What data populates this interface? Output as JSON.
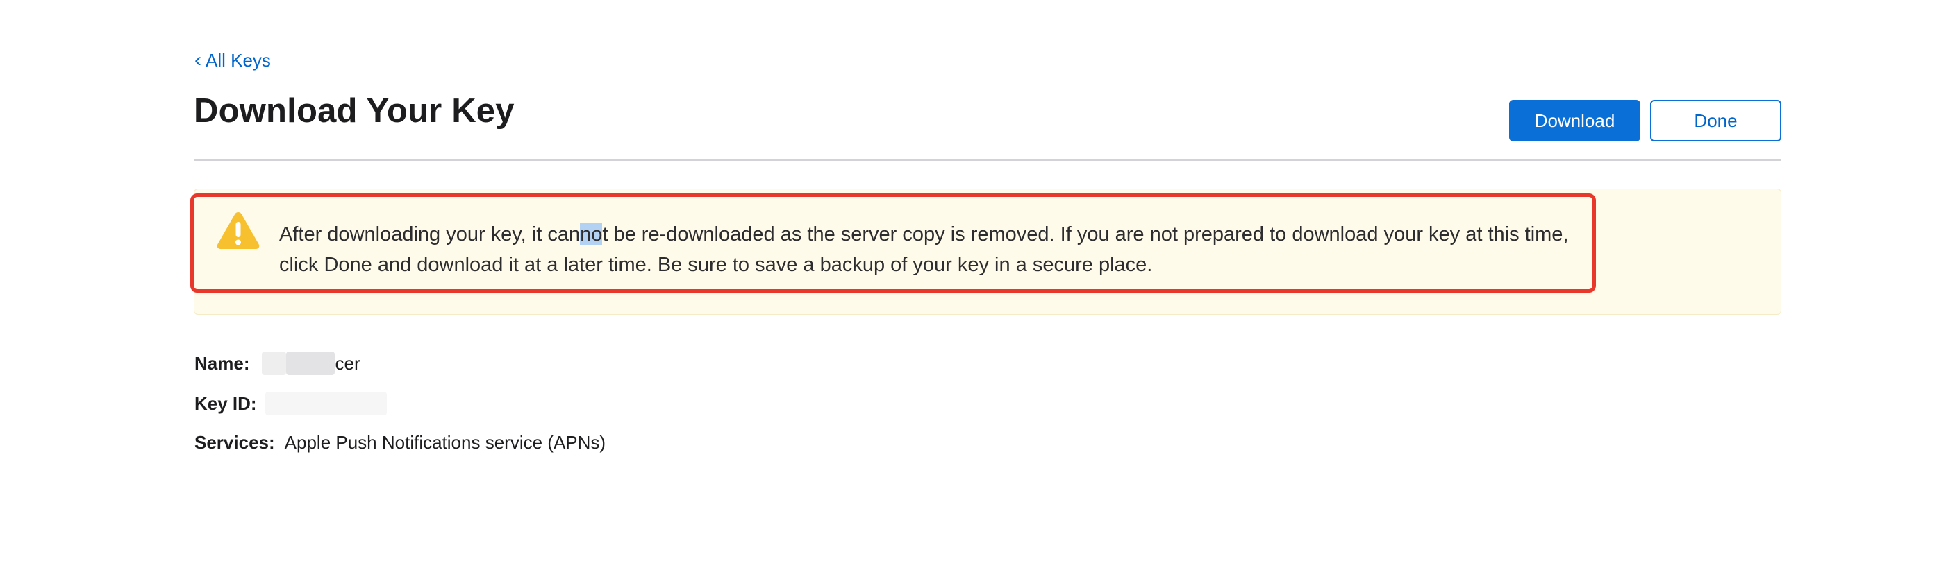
{
  "nav": {
    "back_icon": "chevron-left-icon",
    "back_label": "All Keys"
  },
  "header": {
    "title": "Download Your Key",
    "download_label": "Download",
    "done_label": "Done"
  },
  "warning": {
    "icon": "warning-triangle-icon",
    "icon_color": "#f7c02f",
    "text_before": "After downloading your key, it can",
    "text_selected": "no",
    "text_after": "t be re-downloaded as the server copy is removed. If you are not prepared to download your key at this time, click Done and download it at a later time. Be sure to save a backup of your key in a secure place.",
    "background_color": "#fffbea",
    "highlight_color": "#e8382b"
  },
  "details": {
    "name_label": "Name:",
    "name_value_suffix": "cer",
    "key_id_label": "Key ID:",
    "services_label": "Services:",
    "services_value": "Apple Push Notifications service (APNs)"
  },
  "colors": {
    "accent": "#0a6fd6",
    "link": "#0066cc",
    "divider": "#d2d2d7"
  }
}
